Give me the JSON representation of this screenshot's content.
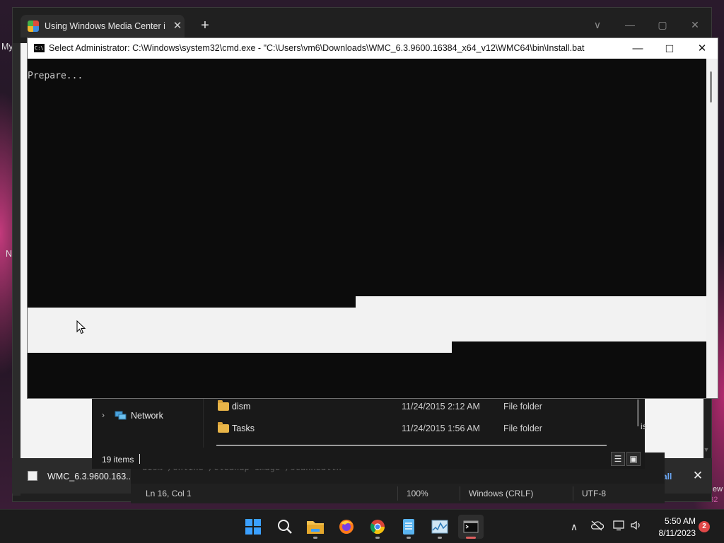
{
  "browser": {
    "tab_title": "Using Windows Media Center in",
    "tab_close_icon": "✕",
    "new_tab_icon": "+",
    "controls": {
      "dropdown": "∨",
      "minimize": "—",
      "maximize": "▢",
      "close": "✕"
    }
  },
  "desktop": {
    "left_labels": [
      "My",
      "N"
    ],
    "right_labels": [
      "is",
      "ew",
      "se.23050-1632"
    ]
  },
  "download_bar": {
    "file_name": "WMC_6.3.9600.163...",
    "show_all": "all",
    "close_icon": "✕"
  },
  "notepad": {
    "faded_line": "dism /online /cleanup-image /scanhealth",
    "status": {
      "position": "Ln 16, Col 1",
      "zoom": "100%",
      "line_ending": "Windows (CRLF)",
      "encoding": "UTF-8"
    }
  },
  "explorer": {
    "nav_item": {
      "label": "Network",
      "chevron": "›"
    },
    "rows": [
      {
        "name": "dism",
        "date": "11/24/2015 2:12 AM",
        "type": "File folder"
      },
      {
        "name": "Tasks",
        "date": "11/24/2015 1:56 AM",
        "type": "File folder"
      }
    ],
    "item_count": "19 items",
    "view_details_icon": "☰",
    "view_tiles_icon": "▣"
  },
  "cmd": {
    "title": "Select Administrator: C:\\Windows\\system32\\cmd.exe - \"C:\\Users\\vm6\\Downloads\\WMC_6.3.9600.16384_x64_v12\\WMC64\\bin\\Install.bat",
    "icon_text": "C:\\",
    "output": "Prepare...",
    "controls": {
      "minimize": "—",
      "maximize": "□",
      "close": "✕"
    }
  },
  "taskbar": {
    "apps": [
      {
        "name": "start"
      },
      {
        "name": "search"
      },
      {
        "name": "file-explorer"
      },
      {
        "name": "firefox"
      },
      {
        "name": "chrome"
      },
      {
        "name": "notepad"
      },
      {
        "name": "resource-monitor"
      },
      {
        "name": "terminal"
      }
    ],
    "tray": {
      "chevron": "∧",
      "volume": "🔈"
    },
    "clock": {
      "time": "5:50 AM",
      "date": "8/11/2023"
    },
    "notification_count": "2"
  },
  "colors": {
    "console_bg": "#0c0c0c",
    "console_text": "#cccccc",
    "taskbar_bg": "#1c1c1c",
    "accent_blue": "#0078d4",
    "folder_yellow": "#e9b548",
    "notification_red": "#e04848"
  }
}
